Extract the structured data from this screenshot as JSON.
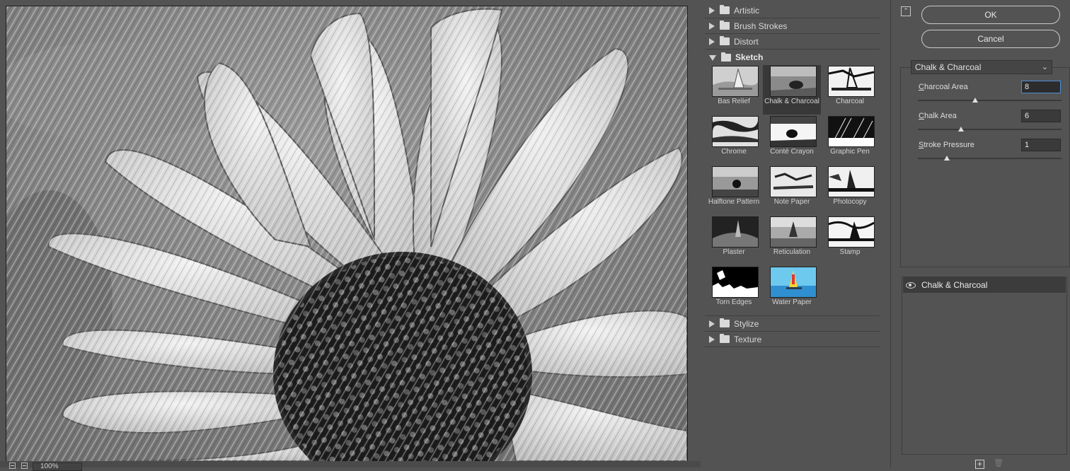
{
  "window": {
    "ok_label": "OK",
    "cancel_label": "Cancel",
    "collapse_icon": "collapse-up-icon"
  },
  "preview": {
    "zoom": "100%",
    "zoom_out_icon": "minus-icon",
    "zoom_in_icon": "plus-icon"
  },
  "gallery": {
    "folders_top": [
      {
        "label": "Artistic"
      },
      {
        "label": "Brush Strokes"
      },
      {
        "label": "Distort"
      },
      {
        "label": "Sketch"
      }
    ],
    "folders_bottom": [
      {
        "label": "Stylize"
      },
      {
        "label": "Texture"
      }
    ],
    "filters": [
      {
        "label": "Bas Relief"
      },
      {
        "label": "Chalk & Charcoal"
      },
      {
        "label": "Charcoal"
      },
      {
        "label": "Chrome"
      },
      {
        "label": "Conté Crayon"
      },
      {
        "label": "Graphic Pen"
      },
      {
        "label": "Halftone Pattern"
      },
      {
        "label": "Note Paper"
      },
      {
        "label": "Photocopy"
      },
      {
        "label": "Plaster"
      },
      {
        "label": "Reticulation"
      },
      {
        "label": "Stamp"
      },
      {
        "label": "Torn Edges"
      },
      {
        "label": "Water Paper"
      }
    ],
    "selected_filter": "Chalk & Charcoal"
  },
  "settings": {
    "filter_name": "Chalk & Charcoal",
    "params": [
      {
        "label_first": "C",
        "label_rest": "harcoal Area",
        "value": "8",
        "slider_fraction": 0.4
      },
      {
        "label_first": "C",
        "label_rest": "halk Area",
        "value": "6",
        "slider_fraction": 0.3
      },
      {
        "label_first": "S",
        "label_rest": "troke Pressure",
        "value": "1",
        "slider_fraction": 0.2
      }
    ]
  },
  "layers": {
    "items": [
      {
        "label": "Chalk & Charcoal",
        "visible": true
      }
    ],
    "new_icon": "new-layer-icon",
    "delete_icon": "trash-icon"
  }
}
